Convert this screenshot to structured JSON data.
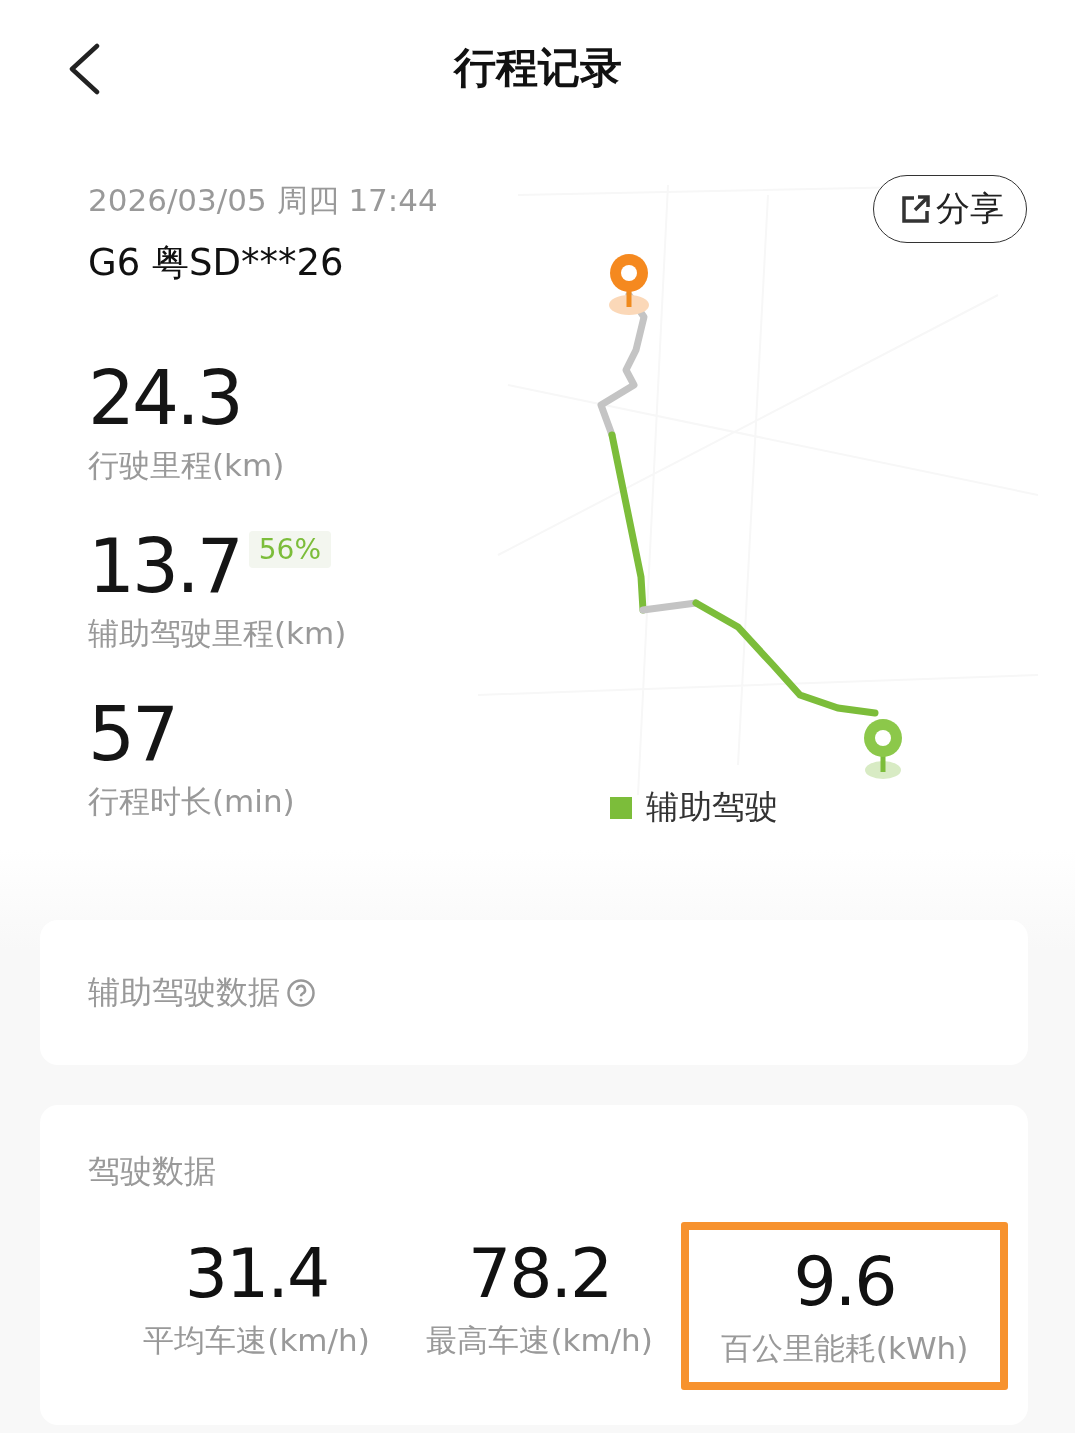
{
  "header": {
    "title": "行程记录"
  },
  "trip": {
    "datetime": "2026/03/05 周四 17:44",
    "vehicle": "G6 粤SD***26",
    "share": "分享"
  },
  "metrics": [
    {
      "value": "24.3",
      "label": "行驶里程(km)"
    },
    {
      "value": "13.7",
      "label": "辅助驾驶里程(km)",
      "badge": "56%"
    },
    {
      "value": "57",
      "label": "行程时长(min)"
    }
  ],
  "map": {
    "legend": [
      {
        "label": "辅助驾驶",
        "color": "#7cbd3a"
      }
    ]
  },
  "assist_card": {
    "title": "辅助驾驶数据"
  },
  "driving_card": {
    "title": "驾驶数据",
    "stats": [
      {
        "value": "31.4",
        "label": "平均车速(km/h)",
        "highlighted": false
      },
      {
        "value": "78.2",
        "label": "最高车速(km/h)",
        "highlighted": false
      },
      {
        "value": "9.6",
        "label": "百公里能耗(kWh)",
        "highlighted": true
      }
    ]
  }
}
